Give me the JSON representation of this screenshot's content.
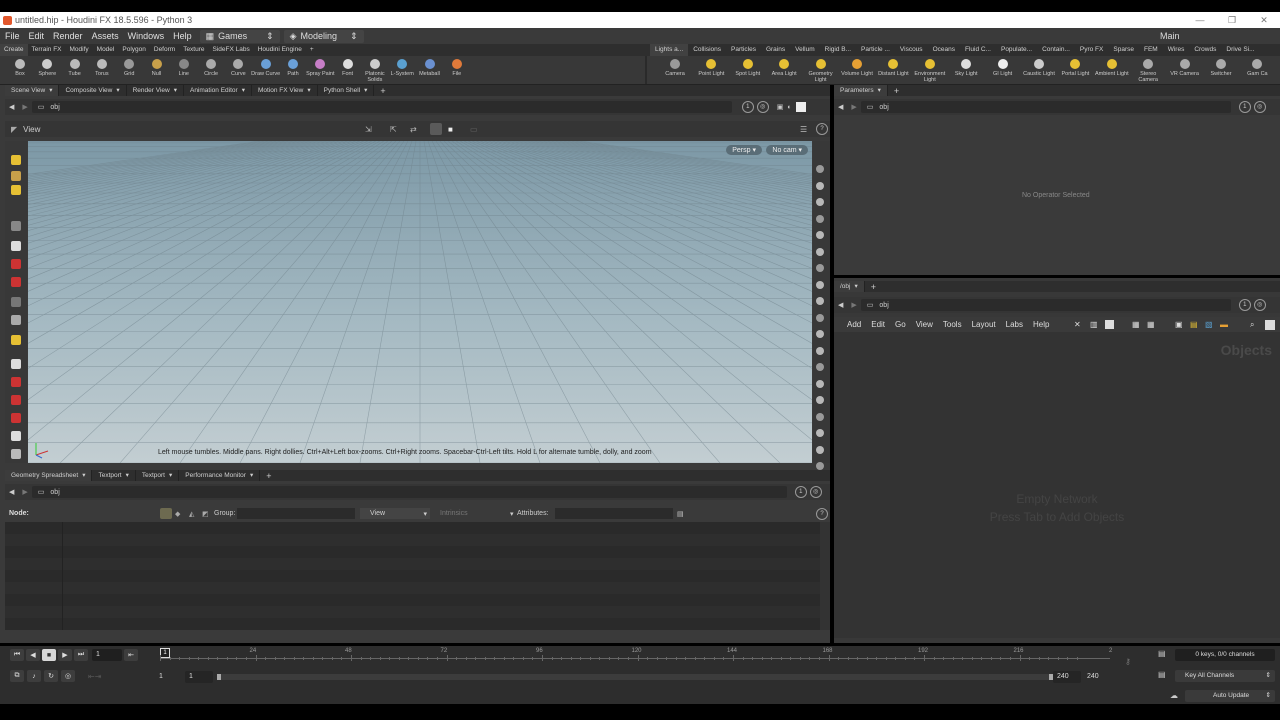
{
  "titlebar": {
    "title": "untitled.hip - Houdini FX 18.5.596 - Python 3",
    "min": "—",
    "max": "❐",
    "close": "✕"
  },
  "menu": {
    "items": [
      "File",
      "Edit",
      "Render",
      "Assets",
      "Windows",
      "Help"
    ],
    "desktop": "Games",
    "context": "Modeling",
    "main": "Main"
  },
  "shelf_tabs_left": [
    "Create",
    "Terrain FX",
    "Modify",
    "Model",
    "Polygon",
    "Deform",
    "Texture",
    "SideFX Labs",
    "Houdini Engine"
  ],
  "shelf_tabs_right": [
    "Lights a...",
    "Collisions",
    "Particles",
    "Grains",
    "Vellum",
    "Rigid B...",
    "Particle ...",
    "Viscous",
    "Oceans",
    "Fluid C...",
    "Populate...",
    "Contain...",
    "Pyro FX",
    "Sparse",
    "FEM",
    "Wires",
    "Crowds",
    "Drive Si..."
  ],
  "tools_left": [
    "Box",
    "Sphere",
    "Tube",
    "Torus",
    "Grid",
    "Null",
    "Line",
    "Circle",
    "Curve",
    "Draw Curve",
    "Path",
    "Spray Paint",
    "Font",
    "Platonic Solids",
    "L-System",
    "Metaball",
    "File"
  ],
  "tools_right": [
    "Camera",
    "Point Light",
    "Spot Light",
    "Area Light",
    "Geometry Light",
    "Volume Light",
    "Distant Light",
    "Environment Light",
    "Sky Light",
    "GI Light",
    "Caustic Light",
    "Portal Light",
    "Ambient Light",
    "Stereo Camera",
    "VR Camera",
    "Switcher",
    "Gam Ca"
  ],
  "colors": {
    "accent": "#e6c034",
    "brand": "#e2572c",
    "panel": "#3a3a3a",
    "viewport_top": "#7c98a6",
    "viewport_bottom": "#c3ced2"
  },
  "viewer_tabs": [
    "Scene View",
    "Composite View",
    "Render View",
    "Animation Editor",
    "Motion FX View",
    "Python Shell"
  ],
  "viewer": {
    "path": "obj",
    "view_label": "View",
    "persp": "Persp ▾",
    "cam": "No cam ▾",
    "hint": "Left mouse tumbles. Middle pans. Right dollies. Ctrl+Alt+Left box-zooms. Ctrl+Right zooms. Spacebar-Ctrl-Left tilts. Hold L for alternate tumble, dolly, and zoom",
    "badge": "1"
  },
  "params": {
    "tab": "Parameters",
    "path": "obj",
    "empty": "No Operator Selected",
    "badge": "1"
  },
  "network": {
    "tab": "/obj",
    "path": "obj",
    "menu": [
      "Add",
      "Edit",
      "Go",
      "View",
      "Tools",
      "Layout",
      "Labs",
      "Help"
    ],
    "watermark": "Objects",
    "empty1": "Empty Network",
    "empty2": "Press Tab to Add Objects",
    "badge": "1"
  },
  "spreadsheet_tabs": [
    "Geometry Spreadsheet",
    "Textport",
    "Textport",
    "Performance Monitor"
  ],
  "spreadsheet": {
    "path": "obj",
    "node_label": "Node:",
    "group_label": "Group:",
    "view_label": "View",
    "intrinsics_label": "Intrinsics",
    "attributes_label": "Attributes:",
    "badge": "1"
  },
  "timeline": {
    "frame": "1",
    "ticks": [
      "1",
      "24",
      "48",
      "72",
      "96",
      "120",
      "144",
      "168",
      "192",
      "216",
      "2"
    ],
    "range_start": "1",
    "range_start2": "1",
    "range_end": "240",
    "range_end2": "240",
    "keys": "0 keys, 0/0 channels",
    "key_all": "Key All Channels",
    "auto_update": "Auto Update"
  }
}
